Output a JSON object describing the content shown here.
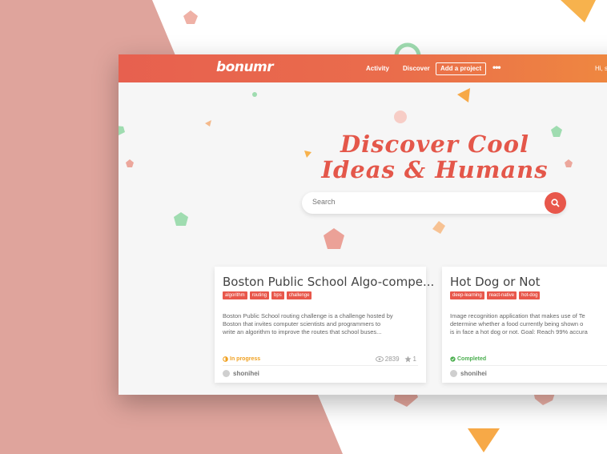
{
  "nav": {
    "logo": "bonumr",
    "links": [
      "Activity",
      "Discover"
    ],
    "add_project": "Add a project",
    "more": "•••",
    "greeting": "Hi, s"
  },
  "hero": {
    "line1": "Discover Cool",
    "line2": "Ideas & Humans"
  },
  "search": {
    "placeholder": "Search",
    "icon": "search-icon"
  },
  "cards": [
    {
      "title": "Boston Public School Algo-compe...",
      "tags": [
        "algorithm",
        "routing",
        "bps",
        "challenge"
      ],
      "description": [
        "Boston Public School routing challenge is a challenge hosted by",
        "Boston that invites computer scientists and programmers to",
        "write an algorithm to improve the routes that school buses..."
      ],
      "status": "In progress",
      "status_color": "#f0a020",
      "views": "2839",
      "stars": "1",
      "author": "shonihei"
    },
    {
      "title": "Hot Dog or Not",
      "tags": [
        "deep-learning",
        "react-native",
        "hot-dog"
      ],
      "description": [
        "Image recognition application that makes use of Te",
        "determine whether a food currently being shown o",
        "is in face a hot dog or not. Goal: Reach 99% accura"
      ],
      "status": "Completed",
      "status_color": "#4caf50",
      "views": "",
      "stars": "",
      "author": "shonihei"
    }
  ],
  "colors": {
    "accent": "#e8574b",
    "background_pink": "#dfa49c",
    "nav_gradient_end": "#ef8a3f"
  }
}
